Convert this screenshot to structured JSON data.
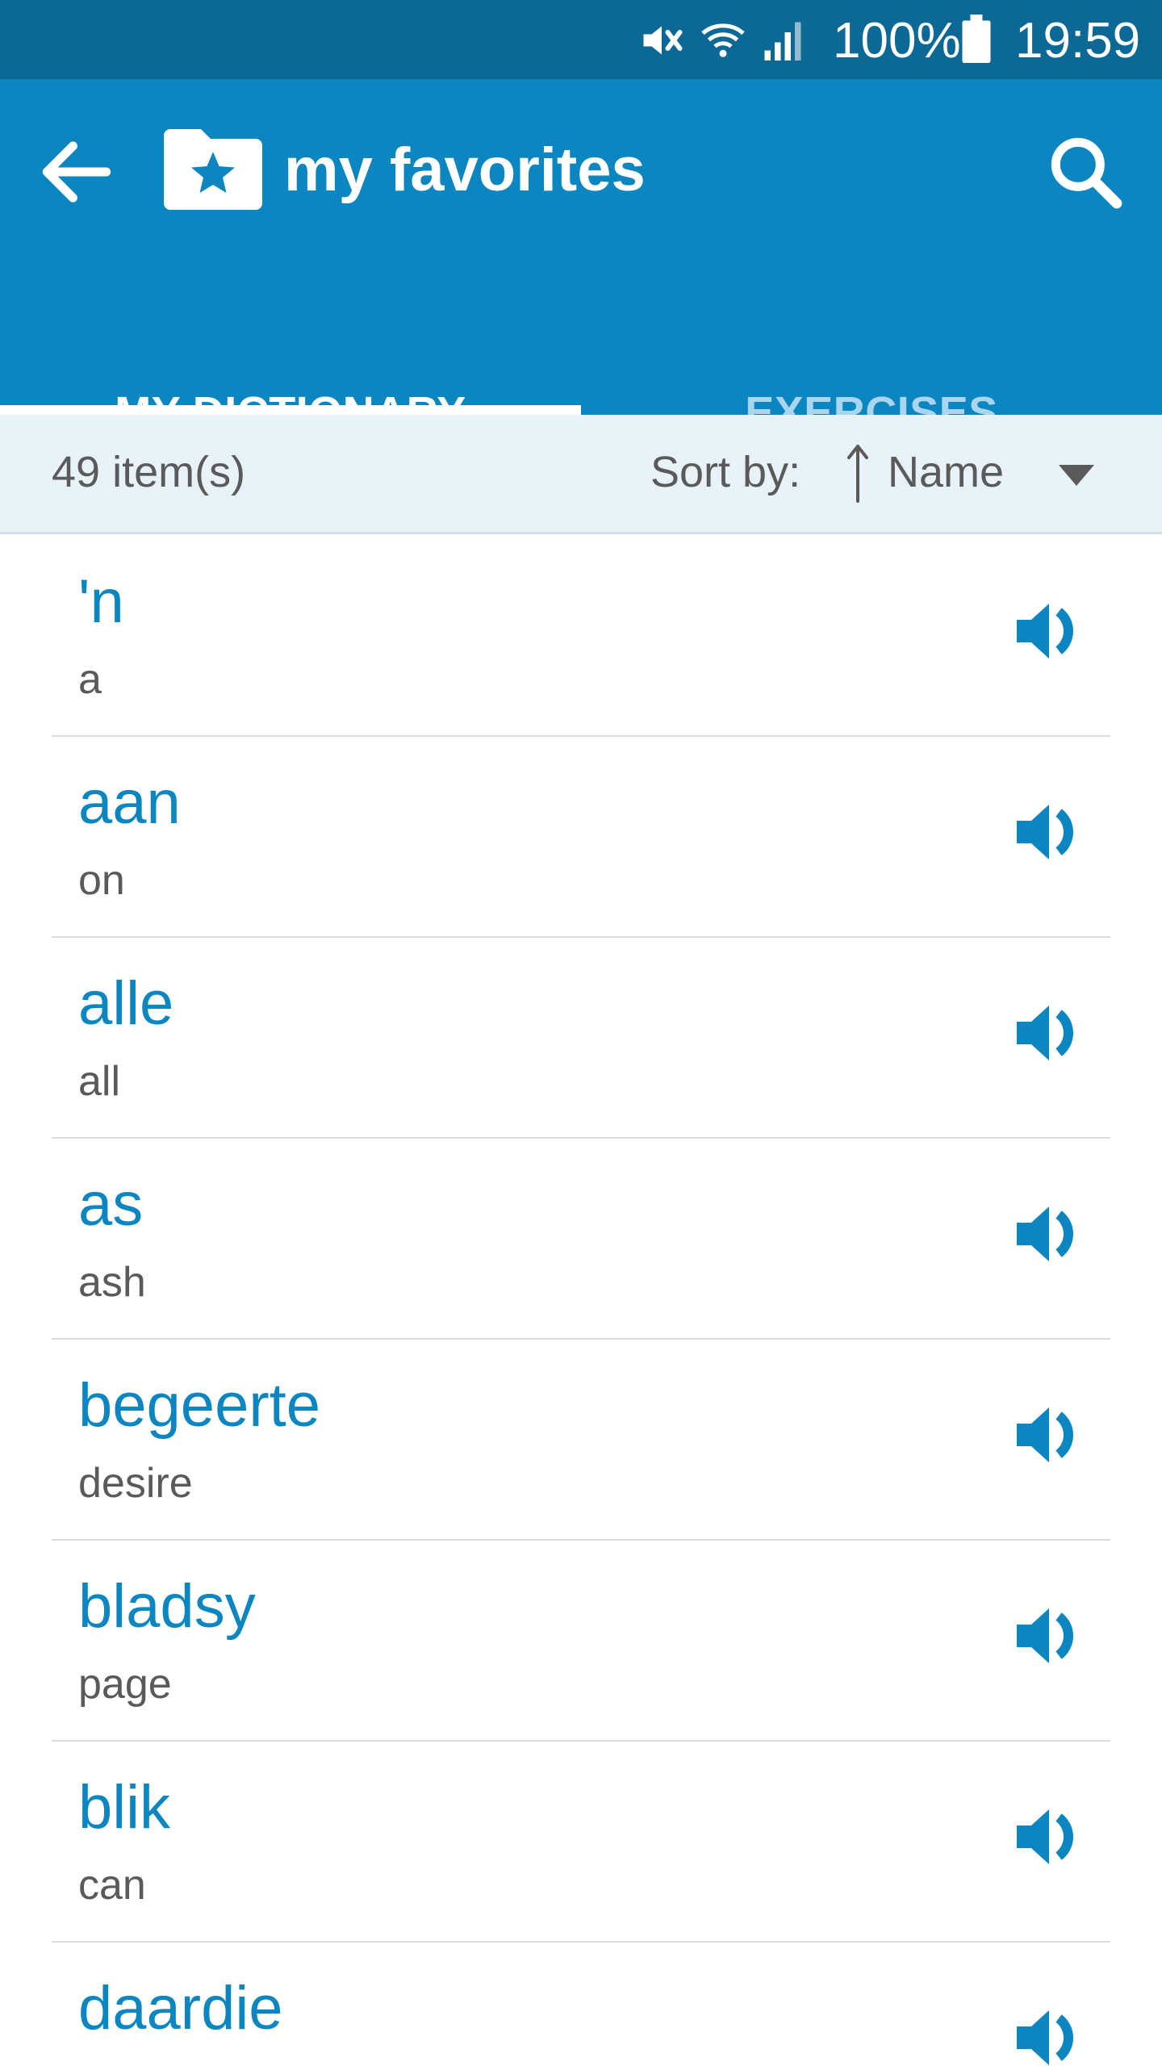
{
  "status_bar": {
    "battery": "100%",
    "time": "19:59"
  },
  "app_bar": {
    "title": "my favorites",
    "tabs": [
      {
        "label": "MY DICTIONARY",
        "selected": true
      },
      {
        "label": "EXERCISES",
        "selected": false
      }
    ]
  },
  "sort_bar": {
    "count": "49 item(s)",
    "sort_label": "Sort by:",
    "sort_value": "Name"
  },
  "entries": [
    {
      "word": "'n",
      "translation": "a"
    },
    {
      "word": "aan",
      "translation": "on"
    },
    {
      "word": "alle",
      "translation": "all"
    },
    {
      "word": "as",
      "translation": "ash"
    },
    {
      "word": "begeerte",
      "translation": "desire"
    },
    {
      "word": "bladsy",
      "translation": "page"
    },
    {
      "word": "blik",
      "translation": "can"
    },
    {
      "word": "daardie",
      "translation": ""
    }
  ],
  "colors": {
    "status_bar": "#0c6894",
    "app_bar": "#0b86c0",
    "accent": "#0b86c0",
    "sort_bar": "#e7f3f9",
    "inactive_tab": "#a9d6ee"
  },
  "icons": {
    "back": "arrow-left-icon",
    "folder": "folder-star-icon",
    "search": "search-icon",
    "speaker": "speaker-icon",
    "dropdown": "caret-down-icon",
    "sort_direction": "arrow-up-icon",
    "mute": "mute-icon",
    "wifi": "wifi-icon",
    "signal": "signal-icon",
    "battery": "battery-icon"
  }
}
